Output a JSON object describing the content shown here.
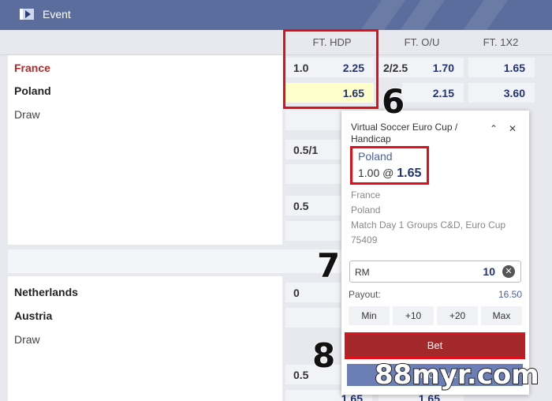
{
  "topbar": {
    "title": "Event",
    "logo_icon": "event-logo-icon"
  },
  "columns": {
    "hdp": "FT. HDP",
    "ou": "FT. O/U",
    "x12": "FT. 1X2"
  },
  "match1": {
    "home": "France",
    "away": "Poland",
    "draw": "Draw",
    "hdp_line": "1.0",
    "hdp_home_odds": "2.25",
    "hdp_away_odds": "1.65",
    "ou_line": "2/2.5",
    "ou_over_odds": "1.70",
    "ou_under_odds": "2.15",
    "x12_home": "1.65",
    "x12_away": "3.60",
    "line2": "0.5/1",
    "line3": "0.5"
  },
  "match2": {
    "home": "Netherlands",
    "away": "Austria",
    "draw": "Draw",
    "line1": "0",
    "line2": "0.5",
    "bottom_odds_a": "1.65",
    "bottom_odds_b": "1.65"
  },
  "slip": {
    "title": "Virtual Soccer Euro Cup / Handicap",
    "selection": "Poland",
    "stake_prefix": "1.00 @",
    "odds": "1.65",
    "info": [
      "France",
      "Poland",
      "Match Day 1 Groups C&D, Euro Cup",
      "75409"
    ],
    "currency": "RM",
    "amount": "10",
    "payout_label": "Payout:",
    "payout_value": "16.50",
    "quick": [
      "Min",
      "+10",
      "+20",
      "Max"
    ],
    "bet_label": "Bet",
    "place_label": "Place bet"
  },
  "annotations": {
    "step6": "6",
    "step7": "7",
    "step8": "8"
  },
  "watermark": "88myr.com",
  "colors": {
    "topbar": "#5a6d9c",
    "highlight": "#e0101a",
    "bet_button": "#a3282a",
    "team_home": "#b12a2a"
  }
}
